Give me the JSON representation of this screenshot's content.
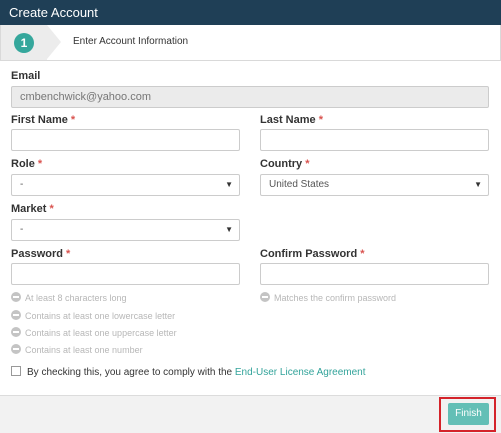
{
  "header": {
    "title": "Create Account"
  },
  "steps": [
    {
      "number": "1",
      "label": "Enter Account Information"
    }
  ],
  "form": {
    "email": {
      "label": "Email",
      "value": "cmbenchwick@yahoo.com"
    },
    "first_name": {
      "label": "First Name",
      "required": "*",
      "value": ""
    },
    "last_name": {
      "label": "Last Name",
      "required": "*",
      "value": ""
    },
    "role": {
      "label": "Role",
      "required": "*",
      "selected": "-",
      "caret": "▼"
    },
    "country": {
      "label": "Country",
      "required": "*",
      "selected": "United States",
      "caret": "▼"
    },
    "market": {
      "label": "Market",
      "required": "*",
      "selected": "-",
      "caret": "▼"
    },
    "password": {
      "label": "Password",
      "required": "*",
      "value": ""
    },
    "confirm_password": {
      "label": "Confirm Password",
      "required": "*",
      "value": ""
    },
    "password_rules": [
      "At least 8 characters long",
      "Contains at least one lowercase letter",
      "Contains at least one uppercase letter",
      "Contains at least one number"
    ],
    "confirm_rule": "Matches the confirm password",
    "agreement": {
      "text": "By checking this, you agree to comply with the ",
      "link": "End-User License Agreement"
    }
  },
  "footer": {
    "finish_label": "Finish"
  },
  "colors": {
    "header_bg": "#1f3f56",
    "accent": "#35a79c",
    "finish_bg": "#63bfb6",
    "required": "#d9534f",
    "highlight": "#d4232a"
  }
}
